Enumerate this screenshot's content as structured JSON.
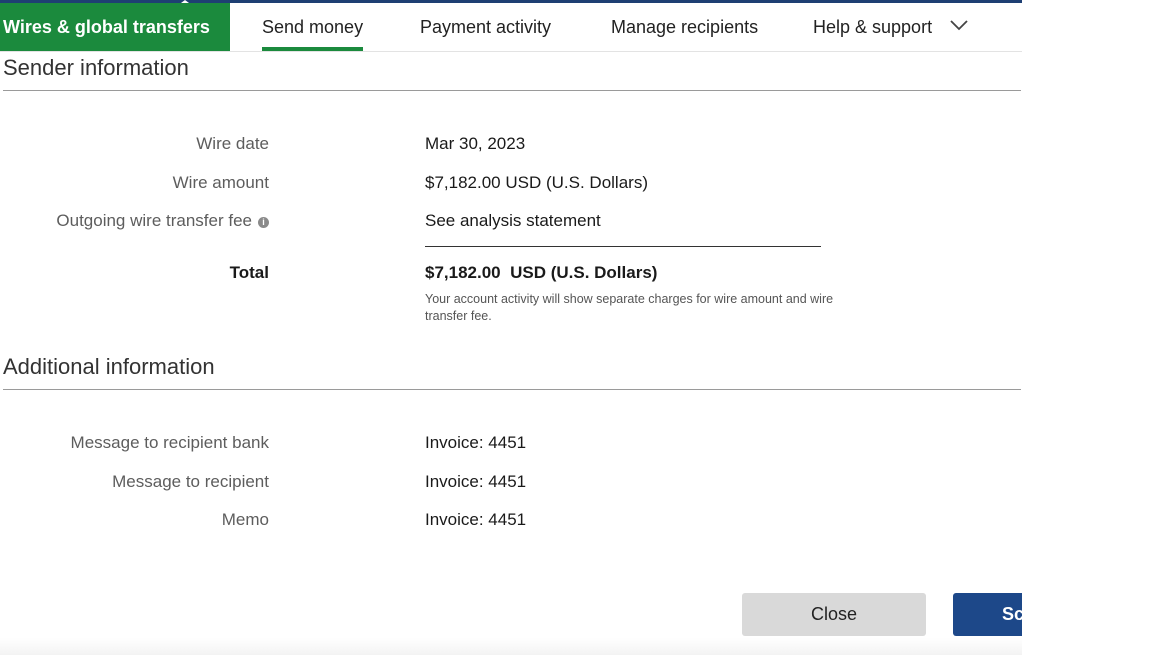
{
  "nav": {
    "brand": "Wires & global transfers",
    "tabs": [
      {
        "label": "Send money",
        "active": true
      },
      {
        "label": "Payment activity",
        "active": false
      },
      {
        "label": "Manage recipients",
        "active": false
      },
      {
        "label": "Help & support",
        "active": false
      }
    ]
  },
  "sender": {
    "title": "Sender information",
    "rows": [
      {
        "label": "Wire date",
        "value": "Mar 30, 2023"
      },
      {
        "label": "Wire amount",
        "value": "$7,182.00 USD (U.S. Dollars)"
      },
      {
        "label": "Outgoing wire transfer fee",
        "value": "See analysis statement"
      }
    ],
    "total": {
      "label": "Total",
      "value": "$7,182.00  USD (U.S. Dollars)",
      "note": "Your account activity will show separate charges for wire amount and wire transfer fee."
    }
  },
  "additional": {
    "title": "Additional information",
    "rows": [
      {
        "label": "Message to recipient bank",
        "value": "Invoice: 4451"
      },
      {
        "label": "Message to recipient",
        "value": "Invoice: 4451"
      },
      {
        "label": "Memo",
        "value": "Invoice: 4451"
      }
    ]
  },
  "actions": {
    "close_label": "Close",
    "send_label": "Sc"
  },
  "colors": {
    "brand_green": "#1b8a3d",
    "primary_blue": "#1d4889",
    "nav_topline": "#1e3f73"
  },
  "icons": {
    "info": "info-icon",
    "chevron": "chevron-down-icon"
  }
}
